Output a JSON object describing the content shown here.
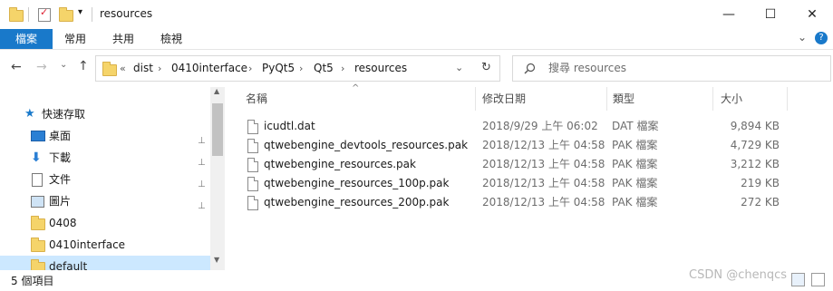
{
  "window": {
    "title": "resources",
    "minimize_glyph": "—",
    "maximize_glyph": "☐",
    "close_glyph": "✕"
  },
  "ribbon": {
    "tabs": [
      {
        "label": "檔案"
      },
      {
        "label": "常用"
      },
      {
        "label": "共用"
      },
      {
        "label": "檢視"
      }
    ],
    "expand_glyph": "⌄",
    "help_glyph": "?"
  },
  "navigation": {
    "back_glyph": "←",
    "forward_glyph": "→",
    "recent_glyph": "⌄",
    "up_glyph": "↑",
    "overflow": "«",
    "breadcrumbs": [
      "dist",
      "0410interface",
      "PyQt5",
      "Qt5",
      "resources"
    ],
    "separator": "›",
    "dropdown_glyph": "⌄",
    "refresh_glyph": "↻",
    "search_placeholder": "搜尋 resources"
  },
  "sidebar": {
    "quick_access_label": "快速存取",
    "items": [
      {
        "label": "桌面",
        "icon": "desktop-icon",
        "pinned": true
      },
      {
        "label": "下載",
        "icon": "download-icon",
        "pinned": true
      },
      {
        "label": "文件",
        "icon": "document-icon",
        "pinned": true
      },
      {
        "label": "圖片",
        "icon": "picture-icon",
        "pinned": true
      },
      {
        "label": "0408",
        "icon": "folder-icon",
        "pinned": false
      },
      {
        "label": "0410interface",
        "icon": "folder-icon",
        "pinned": false
      },
      {
        "label": "default",
        "icon": "folder-icon",
        "pinned": false
      }
    ],
    "pin_glyph": "📌"
  },
  "columns": {
    "name": "名稱",
    "date": "修改日期",
    "type": "類型",
    "size": "大小",
    "sort_glyph": "^"
  },
  "files": [
    {
      "name": "icudtl.dat",
      "date": "2018/9/29 上午 06:02",
      "type": "DAT 檔案",
      "size": "9,894 KB"
    },
    {
      "name": "qtwebengine_devtools_resources.pak",
      "date": "2018/12/13 上午 04:58",
      "type": "PAK 檔案",
      "size": "4,729 KB"
    },
    {
      "name": "qtwebengine_resources.pak",
      "date": "2018/12/13 上午 04:58",
      "type": "PAK 檔案",
      "size": "3,212 KB"
    },
    {
      "name": "qtwebengine_resources_100p.pak",
      "date": "2018/12/13 上午 04:58",
      "type": "PAK 檔案",
      "size": "219 KB"
    },
    {
      "name": "qtwebengine_resources_200p.pak",
      "date": "2018/12/13 上午 04:58",
      "type": "PAK 檔案",
      "size": "272 KB"
    }
  ],
  "status": {
    "item_count": "5 個項目"
  },
  "watermark": "CSDN @chenqcs",
  "colors": {
    "accent": "#1979ca",
    "folder": "#f5d46a"
  }
}
